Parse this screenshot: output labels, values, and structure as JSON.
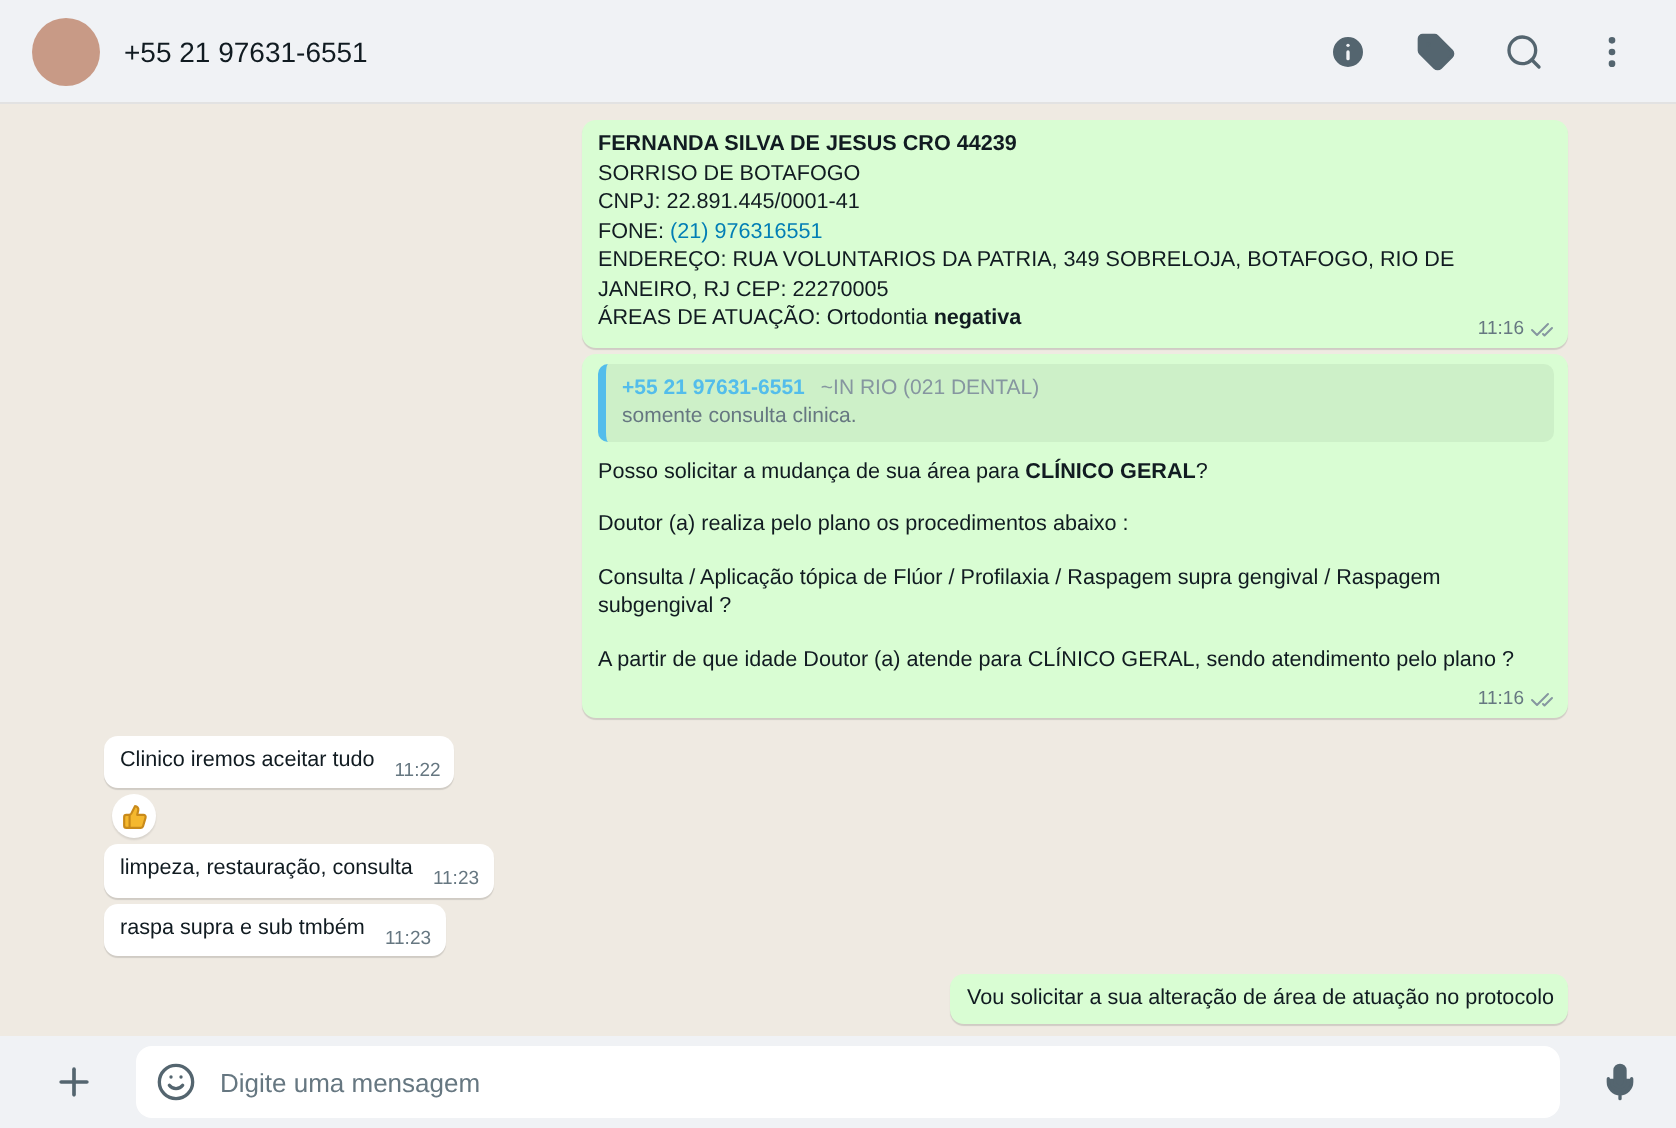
{
  "header": {
    "contact": "+55 21 97631-6551"
  },
  "messages": [
    {
      "outgoing": true,
      "paragraphs": [
        [
          "**FERNANDA SILVA DE JESUS CRO 44239**",
          "SORRISO DE BOTAFOGO",
          "CNPJ: 22.891.445/0001-41",
          {
            "text": "FONE: ",
            "link": "(21) 976316551"
          },
          "ENDEREÇO: RUA VOLUNTARIOS DA PATRIA, 349 SOBRELOJA, BOTAFOGO, RIO DE JANEIRO, RJ CEP: 22270005",
          "ÁREAS DE ATUAÇÃO: Ortodontia **negativa**"
        ]
      ],
      "time": "11:16",
      "read": false,
      "reaction": false
    },
    {
      "outgoing": true,
      "quote": {
        "author": "+55 21 97631-6551",
        "name": "~IN RIO (021 DENTAL)",
        "text": "somente consulta clinica."
      },
      "paragraphs": [
        [
          "Posso solicitar a mudança de sua área para **CLÍNICO GERAL**?"
        ],
        [
          "Doutor (a) realiza pelo plano os procedimentos abaixo :"
        ],
        [
          "Consulta /  Aplicação tópica de Flúor  /  Profilaxia / Raspagem supra gengival / Raspagem subgengival ?"
        ],
        [
          " A partir de que idade Doutor (a) atende para CLÍNICO GERAL, sendo atendimento pelo plano ?"
        ]
      ],
      "time": "11:16",
      "read": false,
      "reaction": false
    },
    {
      "outgoing": false,
      "paragraphs": [
        [
          "Clinico iremos aceitar tudo"
        ]
      ],
      "time": "11:22",
      "reaction": true
    },
    {
      "outgoing": false,
      "paragraphs": [
        [
          "limpeza, restauração, consulta"
        ]
      ],
      "time": "11:23",
      "reaction": false
    },
    {
      "outgoing": false,
      "paragraphs": [
        [
          "raspa supra e sub tmbém"
        ]
      ],
      "time": "11:23",
      "reaction": false
    },
    {
      "outgoing": true,
      "paragraphs": [
        [
          "Vou solicitar a sua alteração de área de atuação no protocolo"
        ]
      ],
      "reaction": false
    }
  ],
  "composer": {
    "placeholder": "Digite uma mensagem"
  }
}
